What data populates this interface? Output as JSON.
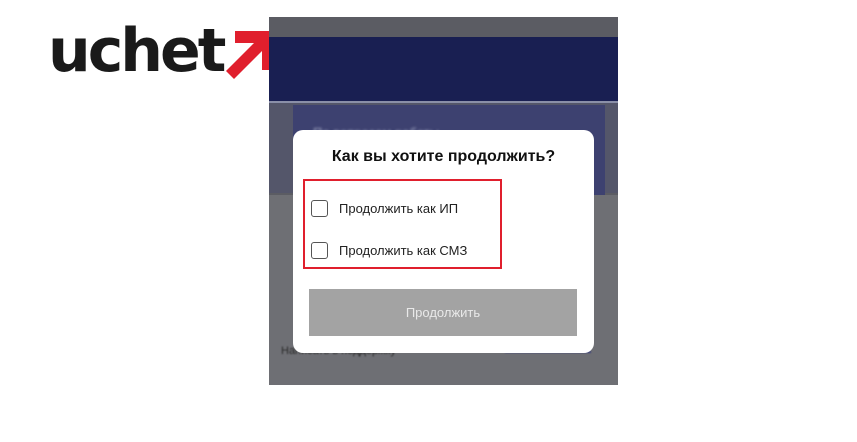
{
  "logo": {
    "text": "uchet",
    "arrow_icon": "diagonal-arrow-icon",
    "text_color": "#1a1a1a",
    "arrow_color": "#e01f2d"
  },
  "background": {
    "card_text": "По вопросам работы",
    "bottom_left_text": "Написать в поддержку",
    "header_color": "#191f52"
  },
  "dialog": {
    "title": "Как вы хотите продолжить?",
    "options": [
      {
        "label": "Продолжить как ИП",
        "checked": false
      },
      {
        "label": "Продолжить как СМЗ",
        "checked": false
      }
    ],
    "continue_label": "Продолжить",
    "continue_disabled": true,
    "highlight_color": "#e01f2d"
  }
}
